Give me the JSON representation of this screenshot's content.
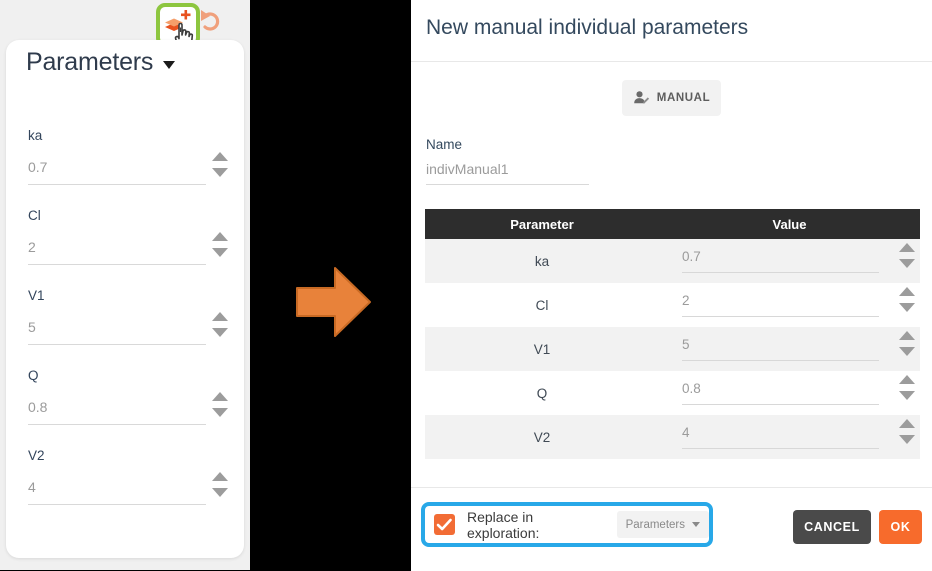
{
  "left_panel": {
    "toolbar": {
      "add_layer_icon": "layers-plus-icon",
      "undo_icon": "undo-arrow-icon",
      "cursor_icon": "hand-pointer-cursor"
    },
    "card": {
      "title": "Parameters",
      "dropdown_icon": "chevron-down-icon",
      "fields": [
        {
          "label": "ka",
          "value": "0.7"
        },
        {
          "label": "Cl",
          "value": "2"
        },
        {
          "label": "V1",
          "value": "5"
        },
        {
          "label": "Q",
          "value": "0.8"
        },
        {
          "label": "V2",
          "value": "4"
        }
      ]
    }
  },
  "transition": {
    "arrow_icon": "right-arrow-icon",
    "arrow_color": "#e8823a"
  },
  "dialog": {
    "title": "New manual individual parameters",
    "mode_button": {
      "label": "MANUAL",
      "icon": "person-edit-icon"
    },
    "name_field": {
      "label": "Name",
      "value": "indivManual1"
    },
    "table": {
      "headers": [
        "Parameter",
        "Value"
      ],
      "rows": [
        {
          "parameter": "ka",
          "value": "0.7"
        },
        {
          "parameter": "Cl",
          "value": "2"
        },
        {
          "parameter": "V1",
          "value": "5"
        },
        {
          "parameter": "Q",
          "value": "0.8"
        },
        {
          "parameter": "V2",
          "value": "4"
        }
      ],
      "header_bg": "#2d2d2d"
    },
    "footer": {
      "replace_label": "Replace in exploration:",
      "replace_checked": true,
      "checkbox_color": "#f26c35",
      "highlight_color": "#28a8e8",
      "exploration_select_value": "Parameters",
      "cancel_label": "CANCEL",
      "ok_label": "OK",
      "cancel_color": "#4a4a4a",
      "ok_color": "#f76b2c"
    }
  }
}
